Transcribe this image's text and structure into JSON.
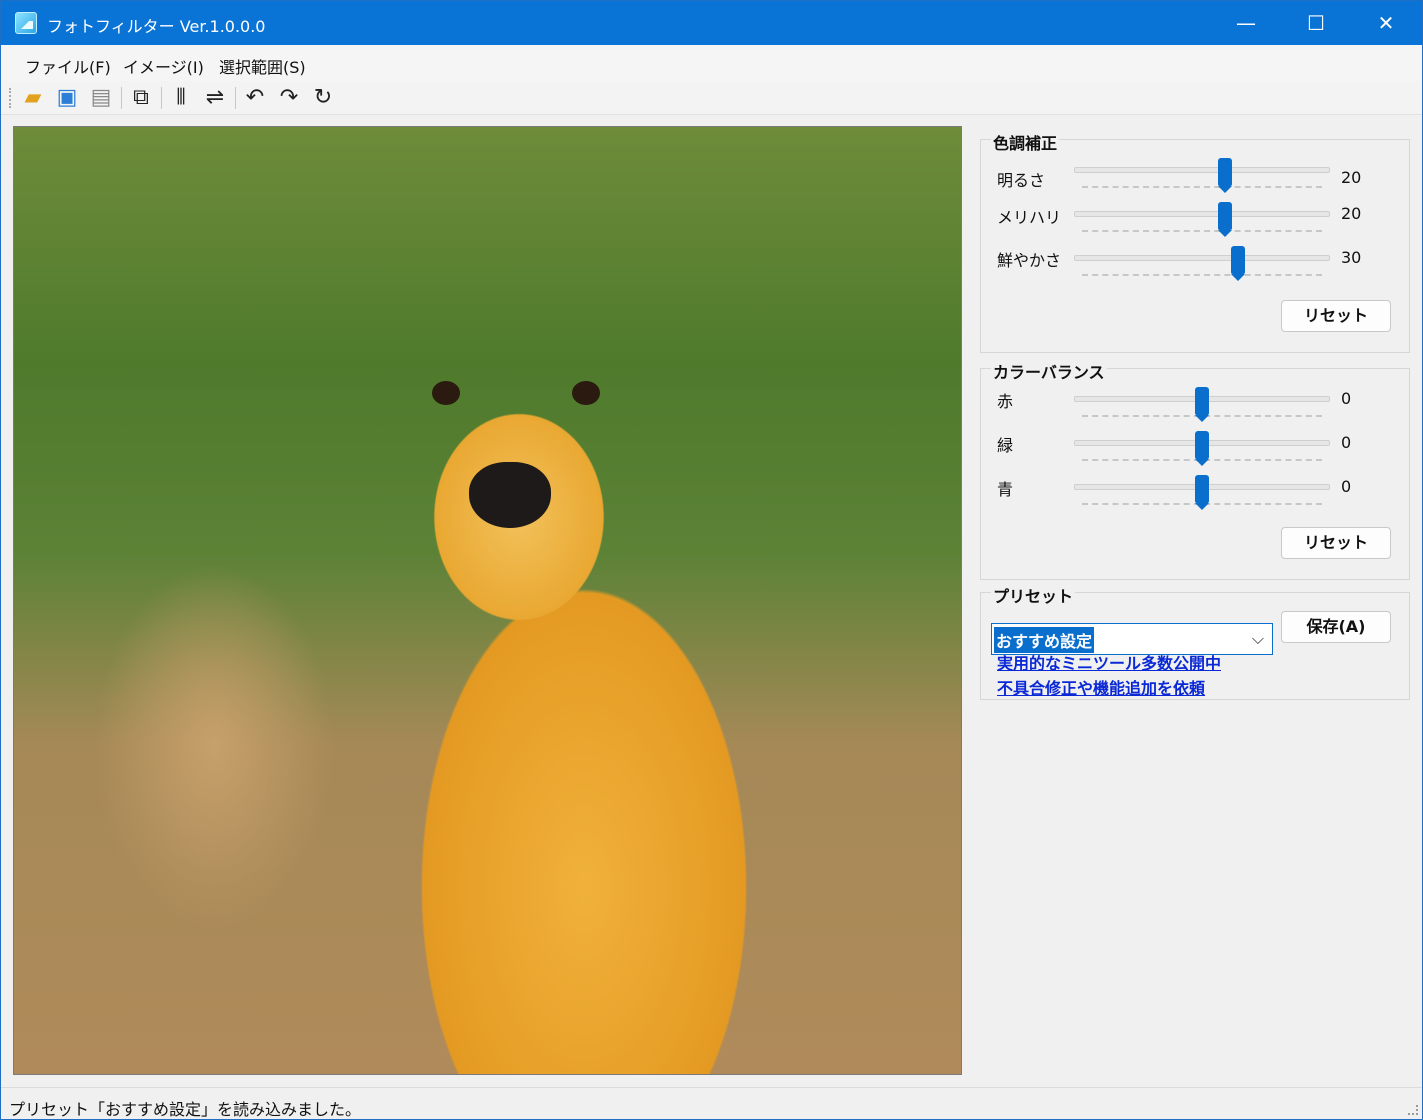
{
  "window": {
    "title": "フォトフィルター Ver.1.0.0.0",
    "minimize": "—",
    "maximize": "☐",
    "close": "✕"
  },
  "menu": [
    "ファイル(F)",
    "イメージ(I)",
    "選択範囲(S)"
  ],
  "toolbar": {
    "icons": [
      "open-folder-icon",
      "save-icon",
      "print-icon",
      "crop-icon",
      "flip-horizontal-icon",
      "flip-vertical-icon",
      "rotate-left-icon",
      "rotate-right-icon",
      "redo-icon"
    ]
  },
  "tone": {
    "title": "色調補正",
    "sliders": [
      {
        "label": "明るさ",
        "value": "20",
        "fraction": 0.59
      },
      {
        "label": "メリハリ",
        "value": "20",
        "fraction": 0.59
      },
      {
        "label": "鮮やかさ",
        "value": "30",
        "fraction": 0.64
      }
    ],
    "reset": "リセット"
  },
  "balance": {
    "title": "カラーバランス",
    "sliders": [
      {
        "label": "赤",
        "value": "0",
        "fraction": 0.5
      },
      {
        "label": "緑",
        "value": "0",
        "fraction": 0.5
      },
      {
        "label": "青",
        "value": "0",
        "fraction": 0.5
      }
    ],
    "reset": "リセット"
  },
  "preset": {
    "title": "プリセット",
    "selected": "おすすめ設定",
    "save": "保存(A)",
    "links": [
      "実用的なミニツール多数公開中",
      "不具合修正や機能追加を依頼"
    ]
  },
  "status": "プリセット「おすすめ設定」を読み込みました。",
  "colors": {
    "accent": "#0a6ecc",
    "titlebar": "#0a74d6",
    "link": "#0a28d6"
  }
}
